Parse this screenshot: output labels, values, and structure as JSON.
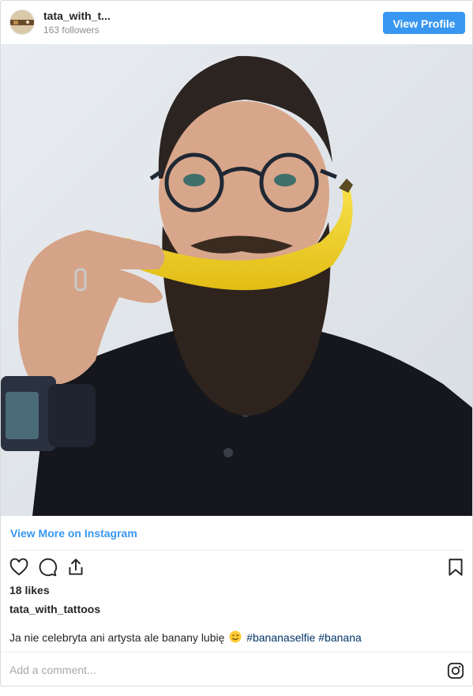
{
  "header": {
    "username": "tata_with_t...",
    "followers": "163 followers",
    "view_profile_label": "View Profile"
  },
  "post": {
    "view_more_label": "View More on Instagram",
    "likes": "18 likes",
    "author": "tata_with_tattoos",
    "caption_text": "Ja nie celebryta ani artysta ale banany lubię",
    "hashtags": [
      "#bananaselfie",
      "#banana"
    ]
  },
  "comment": {
    "placeholder": "Add a comment..."
  },
  "icons": [
    "heart-icon",
    "comment-icon",
    "share-icon",
    "bookmark-icon",
    "instagram-icon"
  ],
  "colors": {
    "accent": "#3897f0",
    "hashtag": "#003569",
    "muted": "#8e8e8e",
    "border": "#dbdbdb"
  }
}
